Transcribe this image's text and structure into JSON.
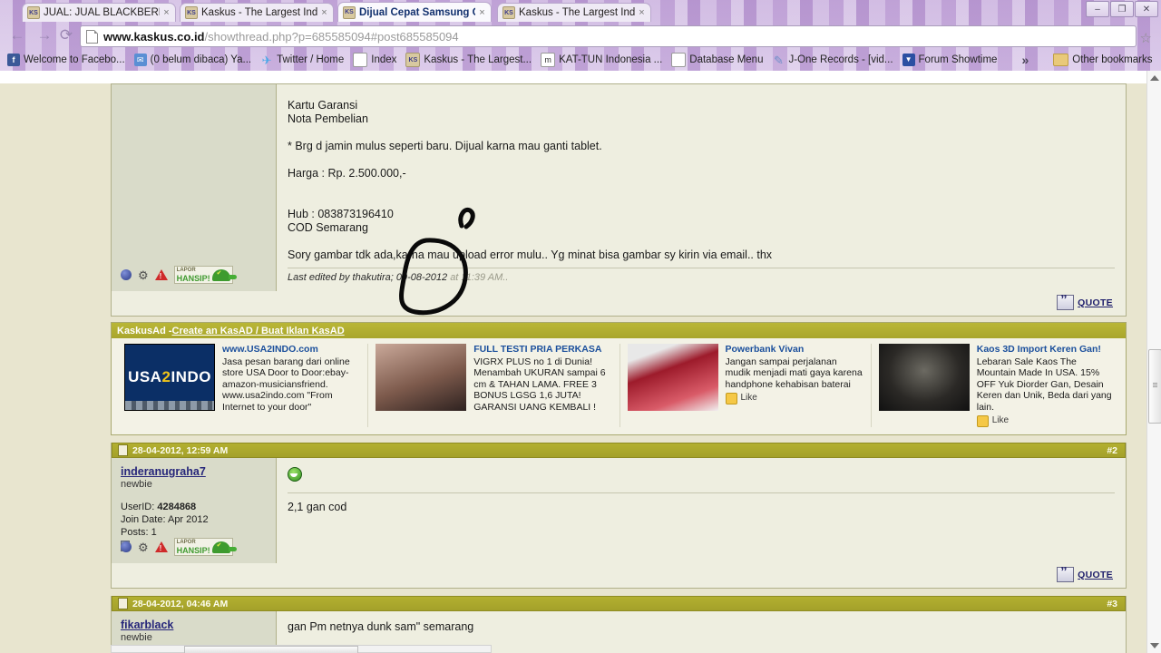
{
  "browser": {
    "tabs": [
      {
        "title": "JUAL: JUAL BLACKBERRY B",
        "favicon": "kaskus-icon",
        "active": false,
        "close": "×"
      },
      {
        "title": "Kaskus - The Largest Indon",
        "favicon": "kaskus-icon",
        "active": false,
        "close": "×"
      },
      {
        "title": "Dijual Cepat Samsung Gala",
        "favicon": "kaskus-icon",
        "active": true,
        "close": "×"
      },
      {
        "title": "Kaskus - The Largest Indon",
        "favicon": "kaskus-icon",
        "active": false,
        "close": "×"
      }
    ],
    "window_controls": {
      "minimize": "–",
      "maximize": "❐",
      "close": "✕"
    },
    "nav": {
      "back": "←",
      "forward": "→",
      "reload": "⟳"
    },
    "omnibox": {
      "domain": "www.kaskus.co.id",
      "path": "/showthread.php?p=685585094#post685585094",
      "star": "☆"
    },
    "bookmarks": [
      {
        "label": "Welcome to Facebo...",
        "icon": "facebook-icon",
        "color": "#3b5998",
        "glyph": "f"
      },
      {
        "label": "(0 belum dibaca) Ya...",
        "icon": "yahoo-mail-icon",
        "color": "#4a7fc1",
        "glyph": "✉"
      },
      {
        "label": "Twitter / Home",
        "icon": "twitter-icon",
        "color": "#ffffff",
        "glyph": "🐦"
      },
      {
        "label": "Index",
        "icon": "page-icon",
        "color": "#ffffff",
        "glyph": "❐"
      },
      {
        "label": "Kaskus - The Largest...",
        "icon": "kaskus-icon",
        "color": "#d8c9a0",
        "glyph": "⚑"
      },
      {
        "label": "KAT-TUN Indonesia ...",
        "icon": "generic-icon",
        "color": "#dddddd",
        "glyph": "m"
      },
      {
        "label": "Database Menu",
        "icon": "page-icon",
        "color": "#ffffff",
        "glyph": "❐"
      },
      {
        "label": "J-One Records - [vid...",
        "icon": "pencil-icon",
        "color": "#ffffff",
        "glyph": "✎"
      },
      {
        "label": "Forum Showtime",
        "icon": "showtime-icon",
        "color": "#2b4fa2",
        "glyph": "▼"
      }
    ],
    "bookmarks_overflow": "»",
    "other_bookmarks": "Other bookmarks"
  },
  "forum": {
    "post1": {
      "message_lines": [
        "Kartu Garansi",
        "Nota Pembelian",
        "",
        "* Brg d jamin mulus seperti baru. Dijual karna mau ganti tablet.",
        "",
        "Harga : Rp. 2.500.000,-",
        "",
        "",
        "Hub : 083873196410",
        "COD Semarang",
        "",
        "Sory gambar tdk ada,karna mau upload error mulu.. Yg minat bisa gambar sy kirin via email.. thx"
      ],
      "last_edited": "Last edited by thakutira; 09-08-2012",
      "last_edited_time": "at 11:39 AM..",
      "quote_label": "QUOTE",
      "lapor_top": "LAPOR",
      "lapor_bottom": "HANSIP!"
    },
    "ad": {
      "header_prefix": "KaskusAd - ",
      "header_link": "Create an KasAD / Buat Iklan KasAD",
      "items": [
        {
          "title": "www.USA2INDO.com",
          "body": "Jasa pesan barang dari online store USA Door to Door:ebay-amazon-musiciansfriend. www.usa2indo.com \"From Internet to your door\"",
          "image": "usa2indo-banner",
          "image_text": "USA2INDO",
          "like": ""
        },
        {
          "title": "FULL TESTI PRIA PERKASA",
          "body": "VIGRX PLUS no 1 di Dunia! Menambah UKURAN sampai 6 cm & TAHAN LAMA. FREE 3 BONUS LGSG 1,6 JUTA! GARANSI UANG KEMBALI !",
          "image": "woman-portrait",
          "image_text": "",
          "like": ""
        },
        {
          "title": "Powerbank Vivan",
          "body": "Jangan sampai perjalanan mudik menjadi mati gaya karena handphone kehabisan baterai",
          "image": "powerbank-photo",
          "image_text": "",
          "like": "Like"
        },
        {
          "title": "Kaos 3D Import Keren Gan!",
          "body": "Lebaran Sale Kaos The Mountain Made In USA. 15% OFF Yuk Diorder Gan, Desain Keren dan Unik, Beda dari yang lain.",
          "image": "tshirt-photo",
          "image_text": "",
          "like": "Like"
        }
      ]
    },
    "post2": {
      "date": "28-04-2012, 12:59 AM",
      "number": "#2",
      "username": "inderanugraha7",
      "usertitle": "newbie",
      "userid_label": "UserID:",
      "userid": "4284868",
      "joindate": "Join Date: Apr 2012",
      "posts": "Posts: 1",
      "message": "2,1 gan cod",
      "quote_label": "QUOTE",
      "lapor_top": "LAPOR",
      "lapor_bottom": "HANSIP!"
    },
    "post3": {
      "date": "28-04-2012, 04:46 AM",
      "number": "#3",
      "username": "fikarblack",
      "usertitle": "newbie",
      "message": "gan Pm netnya dunk sam\" semarang"
    }
  },
  "colors": {
    "page_bg": "#e8e5cf",
    "post_bg": "#eeeee0",
    "user_pane": "#d9dbc9",
    "header_olive": "#b3b030",
    "link_blue": "#26267a",
    "ad_title_blue": "#1b4f9c",
    "chrome_purple": "#c8aedd"
  }
}
